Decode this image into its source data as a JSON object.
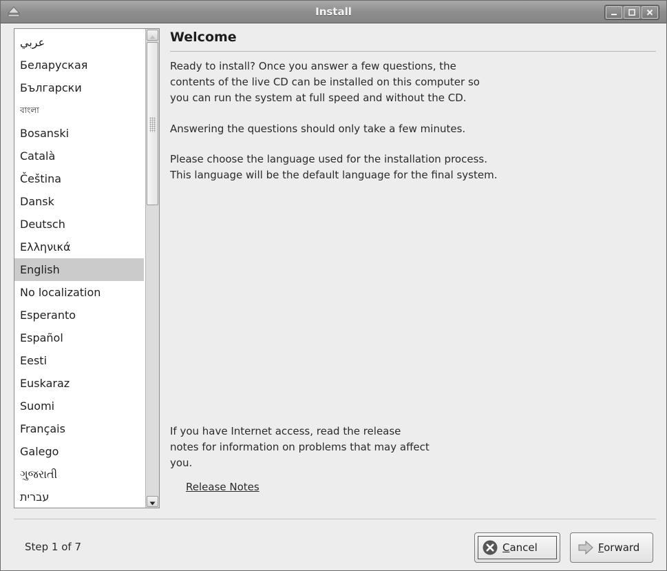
{
  "window": {
    "title": "Install"
  },
  "languages": [
    {
      "label": "عربي",
      "small": false,
      "selected": false
    },
    {
      "label": "Беларуская",
      "small": false,
      "selected": false
    },
    {
      "label": "Български",
      "small": false,
      "selected": false
    },
    {
      "label": "বাংলা",
      "small": true,
      "selected": false
    },
    {
      "label": "Bosanski",
      "small": false,
      "selected": false
    },
    {
      "label": "Català",
      "small": false,
      "selected": false
    },
    {
      "label": "Čeština",
      "small": false,
      "selected": false
    },
    {
      "label": "Dansk",
      "small": false,
      "selected": false
    },
    {
      "label": "Deutsch",
      "small": false,
      "selected": false
    },
    {
      "label": "Ελληνικά",
      "small": false,
      "selected": false
    },
    {
      "label": "English",
      "small": false,
      "selected": true
    },
    {
      "label": "No localization",
      "small": false,
      "selected": false
    },
    {
      "label": "Esperanto",
      "small": false,
      "selected": false
    },
    {
      "label": "Español",
      "small": false,
      "selected": false
    },
    {
      "label": "Eesti",
      "small": false,
      "selected": false
    },
    {
      "label": "Euskaraz",
      "small": false,
      "selected": false
    },
    {
      "label": "Suomi",
      "small": false,
      "selected": false
    },
    {
      "label": "Français",
      "small": false,
      "selected": false
    },
    {
      "label": "Galego",
      "small": false,
      "selected": false
    },
    {
      "label": "ગુજરાતી",
      "small": false,
      "selected": false
    },
    {
      "label": "עברית",
      "small": false,
      "selected": false
    }
  ],
  "main": {
    "heading": "Welcome",
    "paragraph1_line1": "Ready to install? Once you answer a few questions, the",
    "paragraph1_line2": "contents of the live CD can be installed on this computer so",
    "paragraph1_line3": "you can run the system at full speed and without the CD.",
    "paragraph2": "Answering the questions should only take a few minutes.",
    "paragraph3_line1": "Please choose the language used for the installation process.",
    "paragraph3_line2": "This language will be the default language for the final system.",
    "internet_line1": "If you have Internet access, read the release",
    "internet_line2": "notes for information on problems that may affect",
    "internet_line3": "you.",
    "release_notes_link": "Release Notes"
  },
  "footer": {
    "step": "Step 1 of 7",
    "cancel_mnemonic": "C",
    "cancel_rest": "ancel",
    "forward_mnemonic": "F",
    "forward_rest": "orward"
  },
  "colors": {
    "selection": "#cbcbcb",
    "window_bg": "#ededed",
    "titlebar": "#8d8d8d",
    "cancel_icon": "#555555"
  },
  "icons": {
    "window_menu": "eject-icon",
    "minimize": "minimize-icon",
    "maximize": "maximize-icon",
    "close": "close-icon",
    "cancel": "cancel-icon",
    "forward": "forward-arrow-icon"
  }
}
